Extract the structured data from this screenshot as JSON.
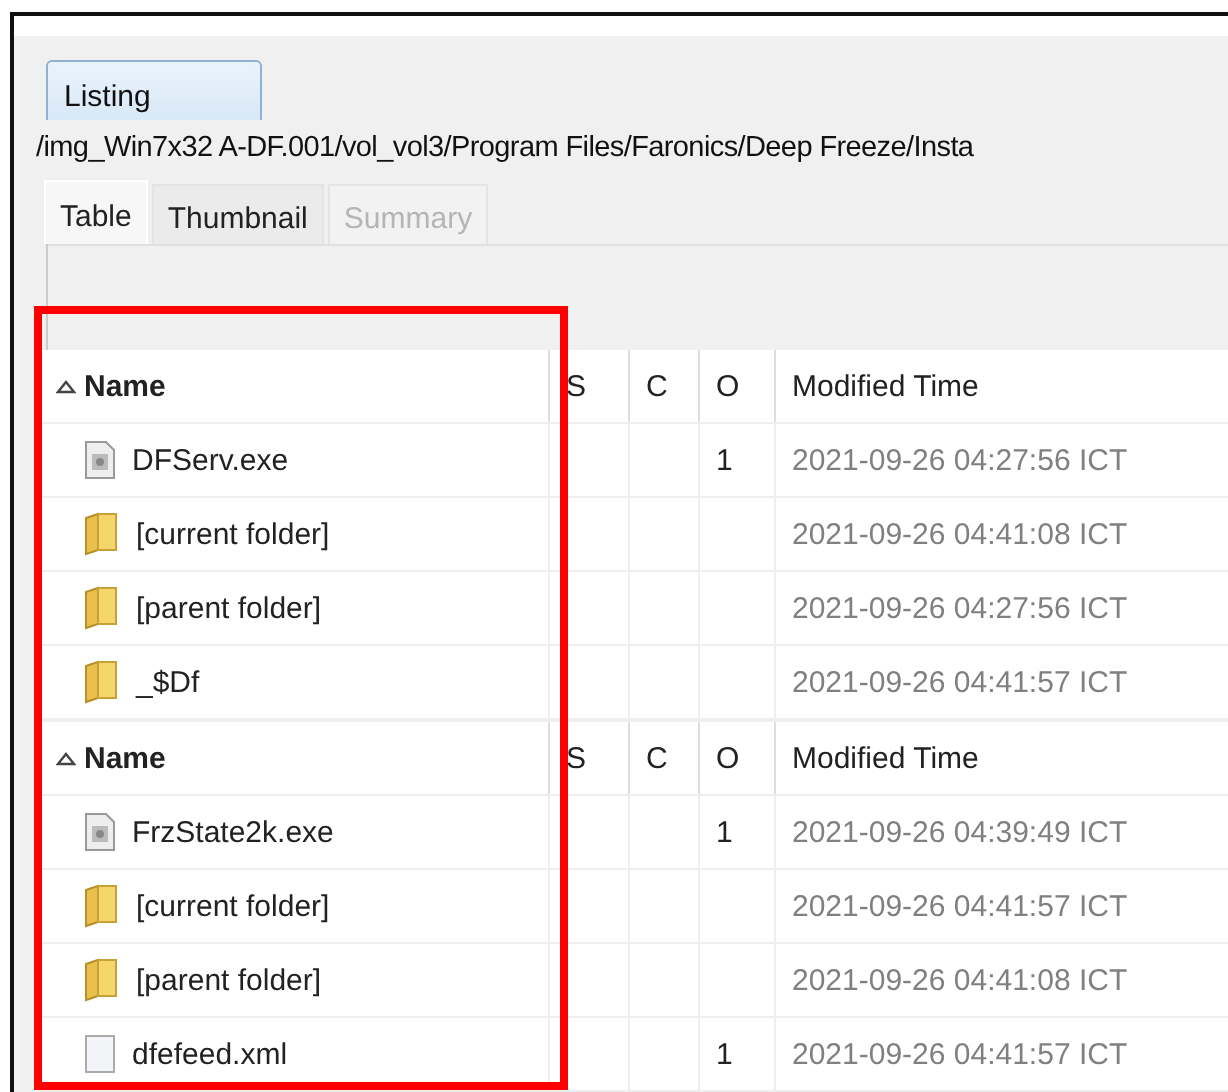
{
  "tabs": [
    {
      "label": "Listing",
      "selected": true
    }
  ],
  "path": "/img_Win7x32 A-DF.001/vol_vol3/Program Files/Faronics/Deep Freeze/Insta",
  "view_tabs": [
    {
      "label": "Table",
      "selected": true,
      "disabled": false
    },
    {
      "label": "Thumbnail",
      "selected": false,
      "disabled": false
    },
    {
      "label": "Summary",
      "selected": false,
      "disabled": true
    }
  ],
  "tables": [
    {
      "columns": [
        {
          "label": "Name",
          "sorted": true
        },
        {
          "label": "S",
          "sorted": false
        },
        {
          "label": "C",
          "sorted": false
        },
        {
          "label": "O",
          "sorted": false
        },
        {
          "label": "Modified Time",
          "sorted": false
        }
      ],
      "rows": [
        {
          "kind": "exe",
          "name": "DFServ.exe",
          "o": "1",
          "modified": "2021-09-26 04:27:56 ICT"
        },
        {
          "kind": "folder",
          "name": "[current folder]",
          "o": "",
          "modified": "2021-09-26 04:41:08 ICT"
        },
        {
          "kind": "folder",
          "name": "[parent folder]",
          "o": "",
          "modified": "2021-09-26 04:27:56 ICT"
        },
        {
          "kind": "folder",
          "name": "_$Df",
          "o": "",
          "modified": "2021-09-26 04:41:57 ICT"
        }
      ]
    },
    {
      "columns": [
        {
          "label": "Name",
          "sorted": true
        },
        {
          "label": "S",
          "sorted": false
        },
        {
          "label": "C",
          "sorted": false
        },
        {
          "label": "O",
          "sorted": false
        },
        {
          "label": "Modified Time",
          "sorted": false
        }
      ],
      "rows": [
        {
          "kind": "exe",
          "name": "FrzState2k.exe",
          "o": "1",
          "modified": "2021-09-26 04:39:49 ICT"
        },
        {
          "kind": "folder",
          "name": "[current folder]",
          "o": "",
          "modified": "2021-09-26 04:41:57 ICT"
        },
        {
          "kind": "folder",
          "name": "[parent folder]",
          "o": "",
          "modified": "2021-09-26 04:41:08 ICT"
        },
        {
          "kind": "file",
          "name": "dfefeed.xml",
          "o": "1",
          "modified": "2021-09-26 04:41:57 ICT"
        }
      ]
    }
  ]
}
